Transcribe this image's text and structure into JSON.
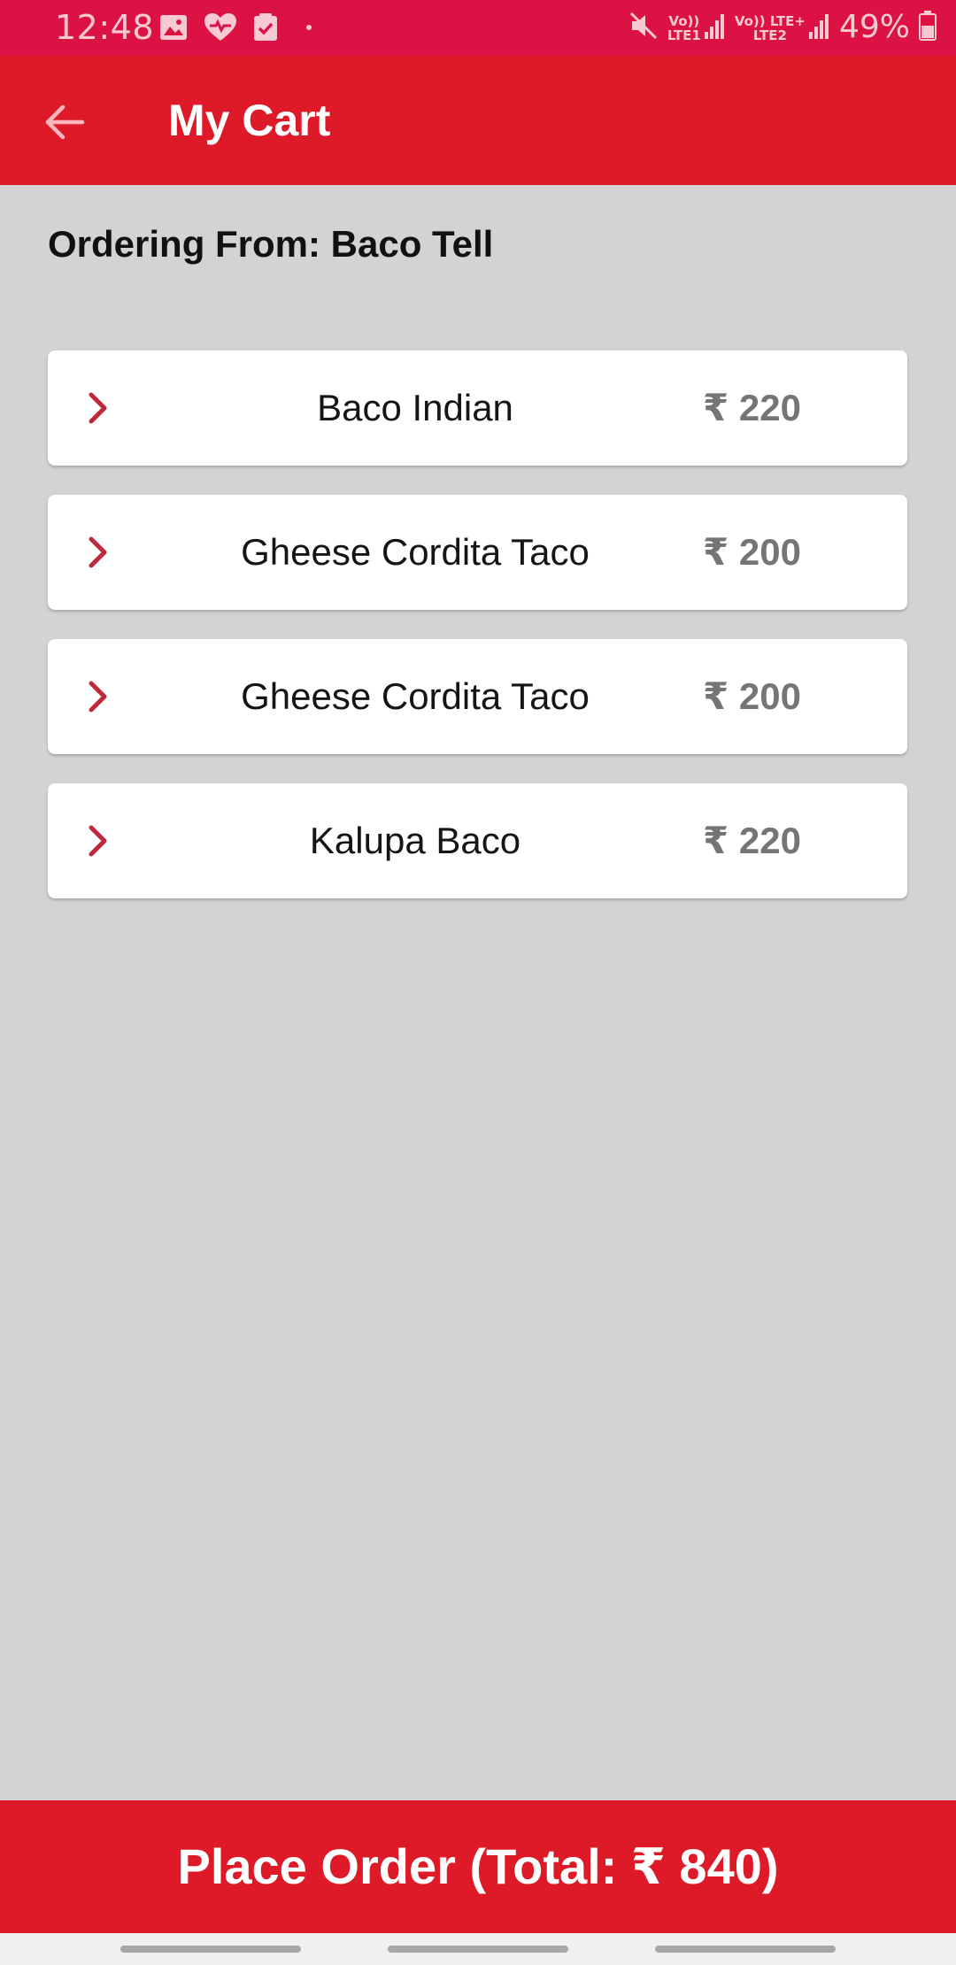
{
  "status_bar": {
    "time": "12:48",
    "notification_icons": [
      "image-icon",
      "heart-icon",
      "check-square-icon"
    ],
    "sim1_label_top": "Vo))",
    "sim1_label_bottom": "LTE1",
    "sim2_label_top": "Vo)) LTE+",
    "sim2_label_bottom": "LTE2",
    "battery": "49%",
    "color": "#dc1244"
  },
  "app_bar": {
    "title": "My Cart",
    "back_icon": "arrow-left-icon",
    "color": "#de1a29"
  },
  "restaurant": {
    "ordering_from": "Ordering From: Baco Tell"
  },
  "cart": {
    "items": [
      {
        "name": "Baco Indian",
        "price": "₹ 220"
      },
      {
        "name": "Gheese Cordita Taco",
        "price": "₹ 200"
      },
      {
        "name": "Gheese Cordita Taco",
        "price": "₹ 200"
      },
      {
        "name": "Kalupa Baco",
        "price": "₹ 220"
      }
    ]
  },
  "place_order": {
    "label": "Place Order (Total: ₹ 840)",
    "color": "#de1a29"
  },
  "theme": {
    "background": "#d3d3d3",
    "chevron": "#c0283c",
    "price_text": "#757575"
  }
}
